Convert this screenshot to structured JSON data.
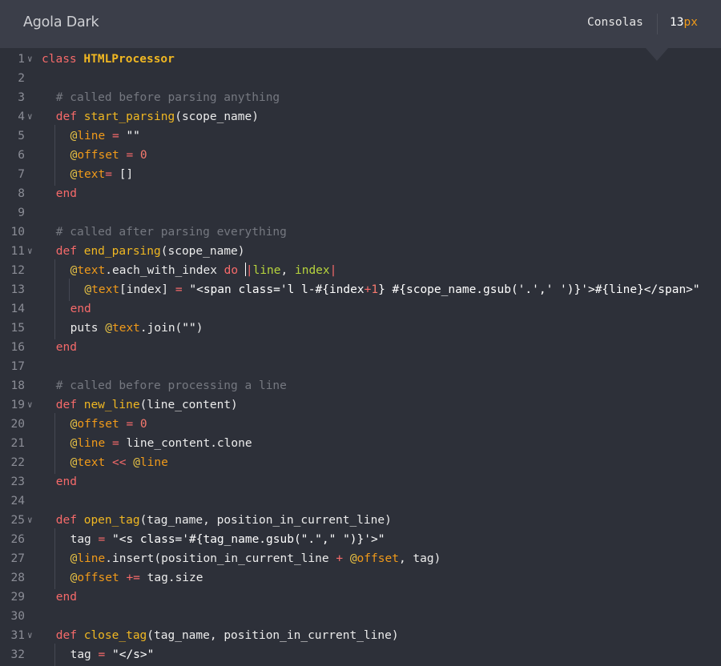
{
  "header": {
    "theme_name": "Agola Dark",
    "font_family": "Consolas",
    "font_size_number": "13",
    "font_size_unit": "px"
  },
  "icons": {
    "fold": "chevron-down-icon"
  },
  "colors": {
    "background": "#2d3039",
    "header": "#3b3e49",
    "keyword": "#f66a6a",
    "function": "#f0b722",
    "instance_var": "#f09a1a",
    "number": "#f6796e",
    "comment": "#757880",
    "block_param": "#b7d43d"
  },
  "lines": [
    {
      "n": "1",
      "fold": true,
      "indent": 0,
      "t": [
        [
          "kw",
          "class "
        ],
        [
          "cls",
          "HTMLProcessor"
        ]
      ]
    },
    {
      "n": "2",
      "fold": false,
      "indent": 0,
      "t": []
    },
    {
      "n": "3",
      "fold": false,
      "indent": 1,
      "t": [
        [
          "cm",
          "# called before parsing anything"
        ]
      ]
    },
    {
      "n": "4",
      "fold": true,
      "indent": 1,
      "t": [
        [
          "kw",
          "def "
        ],
        [
          "fn",
          "start_parsing"
        ],
        [
          "",
          "(scope_name)"
        ]
      ]
    },
    {
      "n": "5",
      "fold": false,
      "indent": 2,
      "t": [
        [
          "ivar",
          "@"
        ],
        [
          "ivn",
          "line"
        ],
        [
          "",
          " "
        ],
        [
          "op",
          "="
        ],
        [
          "",
          " "
        ],
        [
          "str",
          "\"\""
        ]
      ]
    },
    {
      "n": "6",
      "fold": false,
      "indent": 2,
      "t": [
        [
          "ivar",
          "@"
        ],
        [
          "ivn",
          "offset"
        ],
        [
          "",
          " "
        ],
        [
          "op",
          "="
        ],
        [
          "",
          " "
        ],
        [
          "num",
          "0"
        ]
      ]
    },
    {
      "n": "7",
      "fold": false,
      "indent": 2,
      "t": [
        [
          "ivar",
          "@"
        ],
        [
          "ivn",
          "text"
        ],
        [
          "op",
          "="
        ],
        [
          "",
          " []"
        ]
      ]
    },
    {
      "n": "8",
      "fold": false,
      "indent": 1,
      "t": [
        [
          "kw",
          "end"
        ]
      ]
    },
    {
      "n": "9",
      "fold": false,
      "indent": 0,
      "t": []
    },
    {
      "n": "10",
      "fold": false,
      "indent": 1,
      "t": [
        [
          "cm",
          "# called after parsing everything"
        ]
      ]
    },
    {
      "n": "11",
      "fold": true,
      "indent": 1,
      "t": [
        [
          "kw",
          "def "
        ],
        [
          "fn",
          "end_parsing"
        ],
        [
          "",
          "(scope_name)"
        ]
      ]
    },
    {
      "n": "12",
      "fold": false,
      "indent": 2,
      "t": [
        [
          "ivar",
          "@"
        ],
        [
          "ivn",
          "text"
        ],
        [
          "",
          ".each_with_index "
        ],
        [
          "kw",
          "do"
        ],
        [
          "",
          " "
        ],
        [
          "cursor",
          ""
        ],
        [
          "op",
          "|"
        ],
        [
          "blk",
          "line"
        ],
        [
          "",
          ", "
        ],
        [
          "blk",
          "index"
        ],
        [
          "op",
          "|"
        ]
      ]
    },
    {
      "n": "13",
      "fold": false,
      "indent": 3,
      "t": [
        [
          "ivar",
          "@"
        ],
        [
          "ivn",
          "text"
        ],
        [
          "",
          "[index] "
        ],
        [
          "op",
          "="
        ],
        [
          "",
          " "
        ],
        [
          "str",
          "\"<span class='l l-#{index"
        ],
        [
          "op",
          "+"
        ],
        [
          "num",
          "1"
        ],
        [
          "str",
          "} #{scope_name.gsub('.',' ')}'>#{line}</span>\""
        ]
      ]
    },
    {
      "n": "14",
      "fold": false,
      "indent": 2,
      "t": [
        [
          "kw",
          "end"
        ]
      ]
    },
    {
      "n": "15",
      "fold": false,
      "indent": 2,
      "t": [
        [
          "",
          "puts "
        ],
        [
          "ivar",
          "@"
        ],
        [
          "ivn",
          "text"
        ],
        [
          "",
          ".join("
        ],
        [
          "str",
          "\"\""
        ],
        [
          "",
          ")"
        ]
      ]
    },
    {
      "n": "16",
      "fold": false,
      "indent": 1,
      "t": [
        [
          "kw",
          "end"
        ]
      ]
    },
    {
      "n": "17",
      "fold": false,
      "indent": 0,
      "t": []
    },
    {
      "n": "18",
      "fold": false,
      "indent": 1,
      "t": [
        [
          "cm",
          "# called before processing a line"
        ]
      ]
    },
    {
      "n": "19",
      "fold": true,
      "indent": 1,
      "t": [
        [
          "kw",
          "def "
        ],
        [
          "fn",
          "new_line"
        ],
        [
          "",
          "(line_content)"
        ]
      ]
    },
    {
      "n": "20",
      "fold": false,
      "indent": 2,
      "t": [
        [
          "ivar",
          "@"
        ],
        [
          "ivn",
          "offset"
        ],
        [
          "",
          " "
        ],
        [
          "op",
          "="
        ],
        [
          "",
          " "
        ],
        [
          "num",
          "0"
        ]
      ]
    },
    {
      "n": "21",
      "fold": false,
      "indent": 2,
      "t": [
        [
          "ivar",
          "@"
        ],
        [
          "ivn",
          "line"
        ],
        [
          "",
          " "
        ],
        [
          "op",
          "="
        ],
        [
          "",
          " line_content.clone"
        ]
      ]
    },
    {
      "n": "22",
      "fold": false,
      "indent": 2,
      "t": [
        [
          "ivar",
          "@"
        ],
        [
          "ivn",
          "text"
        ],
        [
          "",
          " "
        ],
        [
          "op",
          "<<"
        ],
        [
          "",
          " "
        ],
        [
          "ivar",
          "@"
        ],
        [
          "ivn",
          "line"
        ]
      ]
    },
    {
      "n": "23",
      "fold": false,
      "indent": 1,
      "t": [
        [
          "kw",
          "end"
        ]
      ]
    },
    {
      "n": "24",
      "fold": false,
      "indent": 0,
      "t": []
    },
    {
      "n": "25",
      "fold": true,
      "indent": 1,
      "t": [
        [
          "kw",
          "def "
        ],
        [
          "fn",
          "open_tag"
        ],
        [
          "",
          "(tag_name, position_in_current_line)"
        ]
      ]
    },
    {
      "n": "26",
      "fold": false,
      "indent": 2,
      "t": [
        [
          "",
          "tag "
        ],
        [
          "op",
          "="
        ],
        [
          "",
          " "
        ],
        [
          "str",
          "\"<s class='#{tag_name.gsub(\".\",\" \")}'>\""
        ]
      ]
    },
    {
      "n": "27",
      "fold": false,
      "indent": 2,
      "t": [
        [
          "ivar",
          "@"
        ],
        [
          "ivn",
          "line"
        ],
        [
          "",
          ".insert(position_in_current_line "
        ],
        [
          "op",
          "+"
        ],
        [
          "",
          " "
        ],
        [
          "ivar",
          "@"
        ],
        [
          "ivn",
          "offset"
        ],
        [
          "",
          ", tag)"
        ]
      ]
    },
    {
      "n": "28",
      "fold": false,
      "indent": 2,
      "t": [
        [
          "ivar",
          "@"
        ],
        [
          "ivn",
          "offset"
        ],
        [
          "",
          " "
        ],
        [
          "op",
          "+="
        ],
        [
          "",
          " tag.size"
        ]
      ]
    },
    {
      "n": "29",
      "fold": false,
      "indent": 1,
      "t": [
        [
          "kw",
          "end"
        ]
      ]
    },
    {
      "n": "30",
      "fold": false,
      "indent": 0,
      "t": []
    },
    {
      "n": "31",
      "fold": true,
      "indent": 1,
      "t": [
        [
          "kw",
          "def "
        ],
        [
          "fn",
          "close_tag"
        ],
        [
          "",
          "(tag_name, position_in_current_line)"
        ]
      ]
    },
    {
      "n": "32",
      "fold": false,
      "indent": 2,
      "t": [
        [
          "",
          "tag "
        ],
        [
          "op",
          "="
        ],
        [
          "",
          " "
        ],
        [
          "str",
          "\"</s>\""
        ]
      ]
    }
  ]
}
